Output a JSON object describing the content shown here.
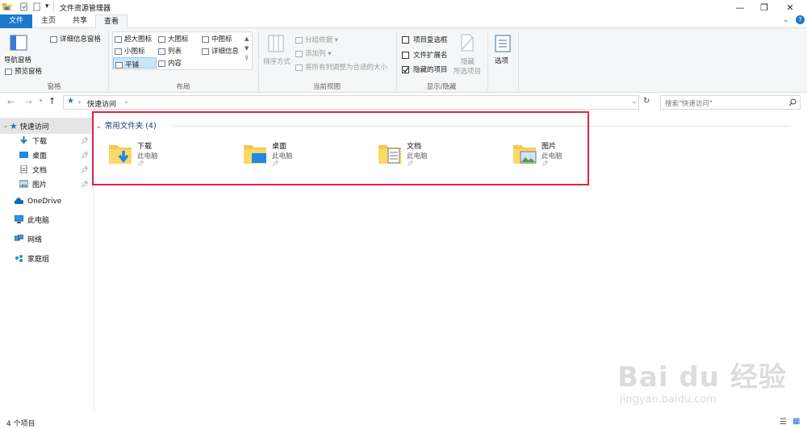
{
  "window": {
    "title": "文件资源管理器"
  },
  "tabs": [
    "文件",
    "主页",
    "共享",
    "查看"
  ],
  "ribbon": {
    "panes": {
      "nav_pane": "导航窗格",
      "preview_pane": "预览窗格",
      "details_pane": "详细信息窗格",
      "group_label": "窗格"
    },
    "layout": {
      "items": [
        "超大图标",
        "大图标",
        "中图标",
        "小图标",
        "列表",
        "详细信息",
        "平铺",
        "内容"
      ],
      "group_label": "布局"
    },
    "current_view": {
      "sort_by": "排序方式",
      "group_by": "分组依据",
      "add_columns": "添加列",
      "size_columns": "将所有列调整为合适的大小",
      "group_label": "当前视图"
    },
    "show_hide": {
      "item_checkboxes": "项目复选框",
      "file_extensions": "文件扩展名",
      "hidden_items": "隐藏的项目",
      "hide_selected": "隐藏",
      "hide_selected_2": "所选项目",
      "group_label": "显示/隐藏"
    },
    "options": "选项"
  },
  "address": {
    "path": "快速访问",
    "search_placeholder": "搜索\"快速访问\""
  },
  "nav": {
    "quick_access": "快速访问",
    "pinned": [
      "下载",
      "桌面",
      "文档",
      "图片"
    ],
    "onedrive": "OneDrive",
    "this_pc": "此电脑",
    "network": "网络",
    "homegroup": "家庭组"
  },
  "content": {
    "section_title": "常用文件夹 (4)",
    "folders": [
      {
        "name": "下载",
        "location": "此电脑"
      },
      {
        "name": "桌面",
        "location": "此电脑"
      },
      {
        "name": "文档",
        "location": "此电脑"
      },
      {
        "name": "图片",
        "location": "此电脑"
      }
    ]
  },
  "status": {
    "count": "4 个项目"
  },
  "watermark": {
    "brand": "Bai du 经验",
    "url": "jingyan.baidu.com"
  },
  "colors": {
    "accent": "#1979ca",
    "highlight": "#e5243b",
    "folder": "#f5c84c"
  }
}
